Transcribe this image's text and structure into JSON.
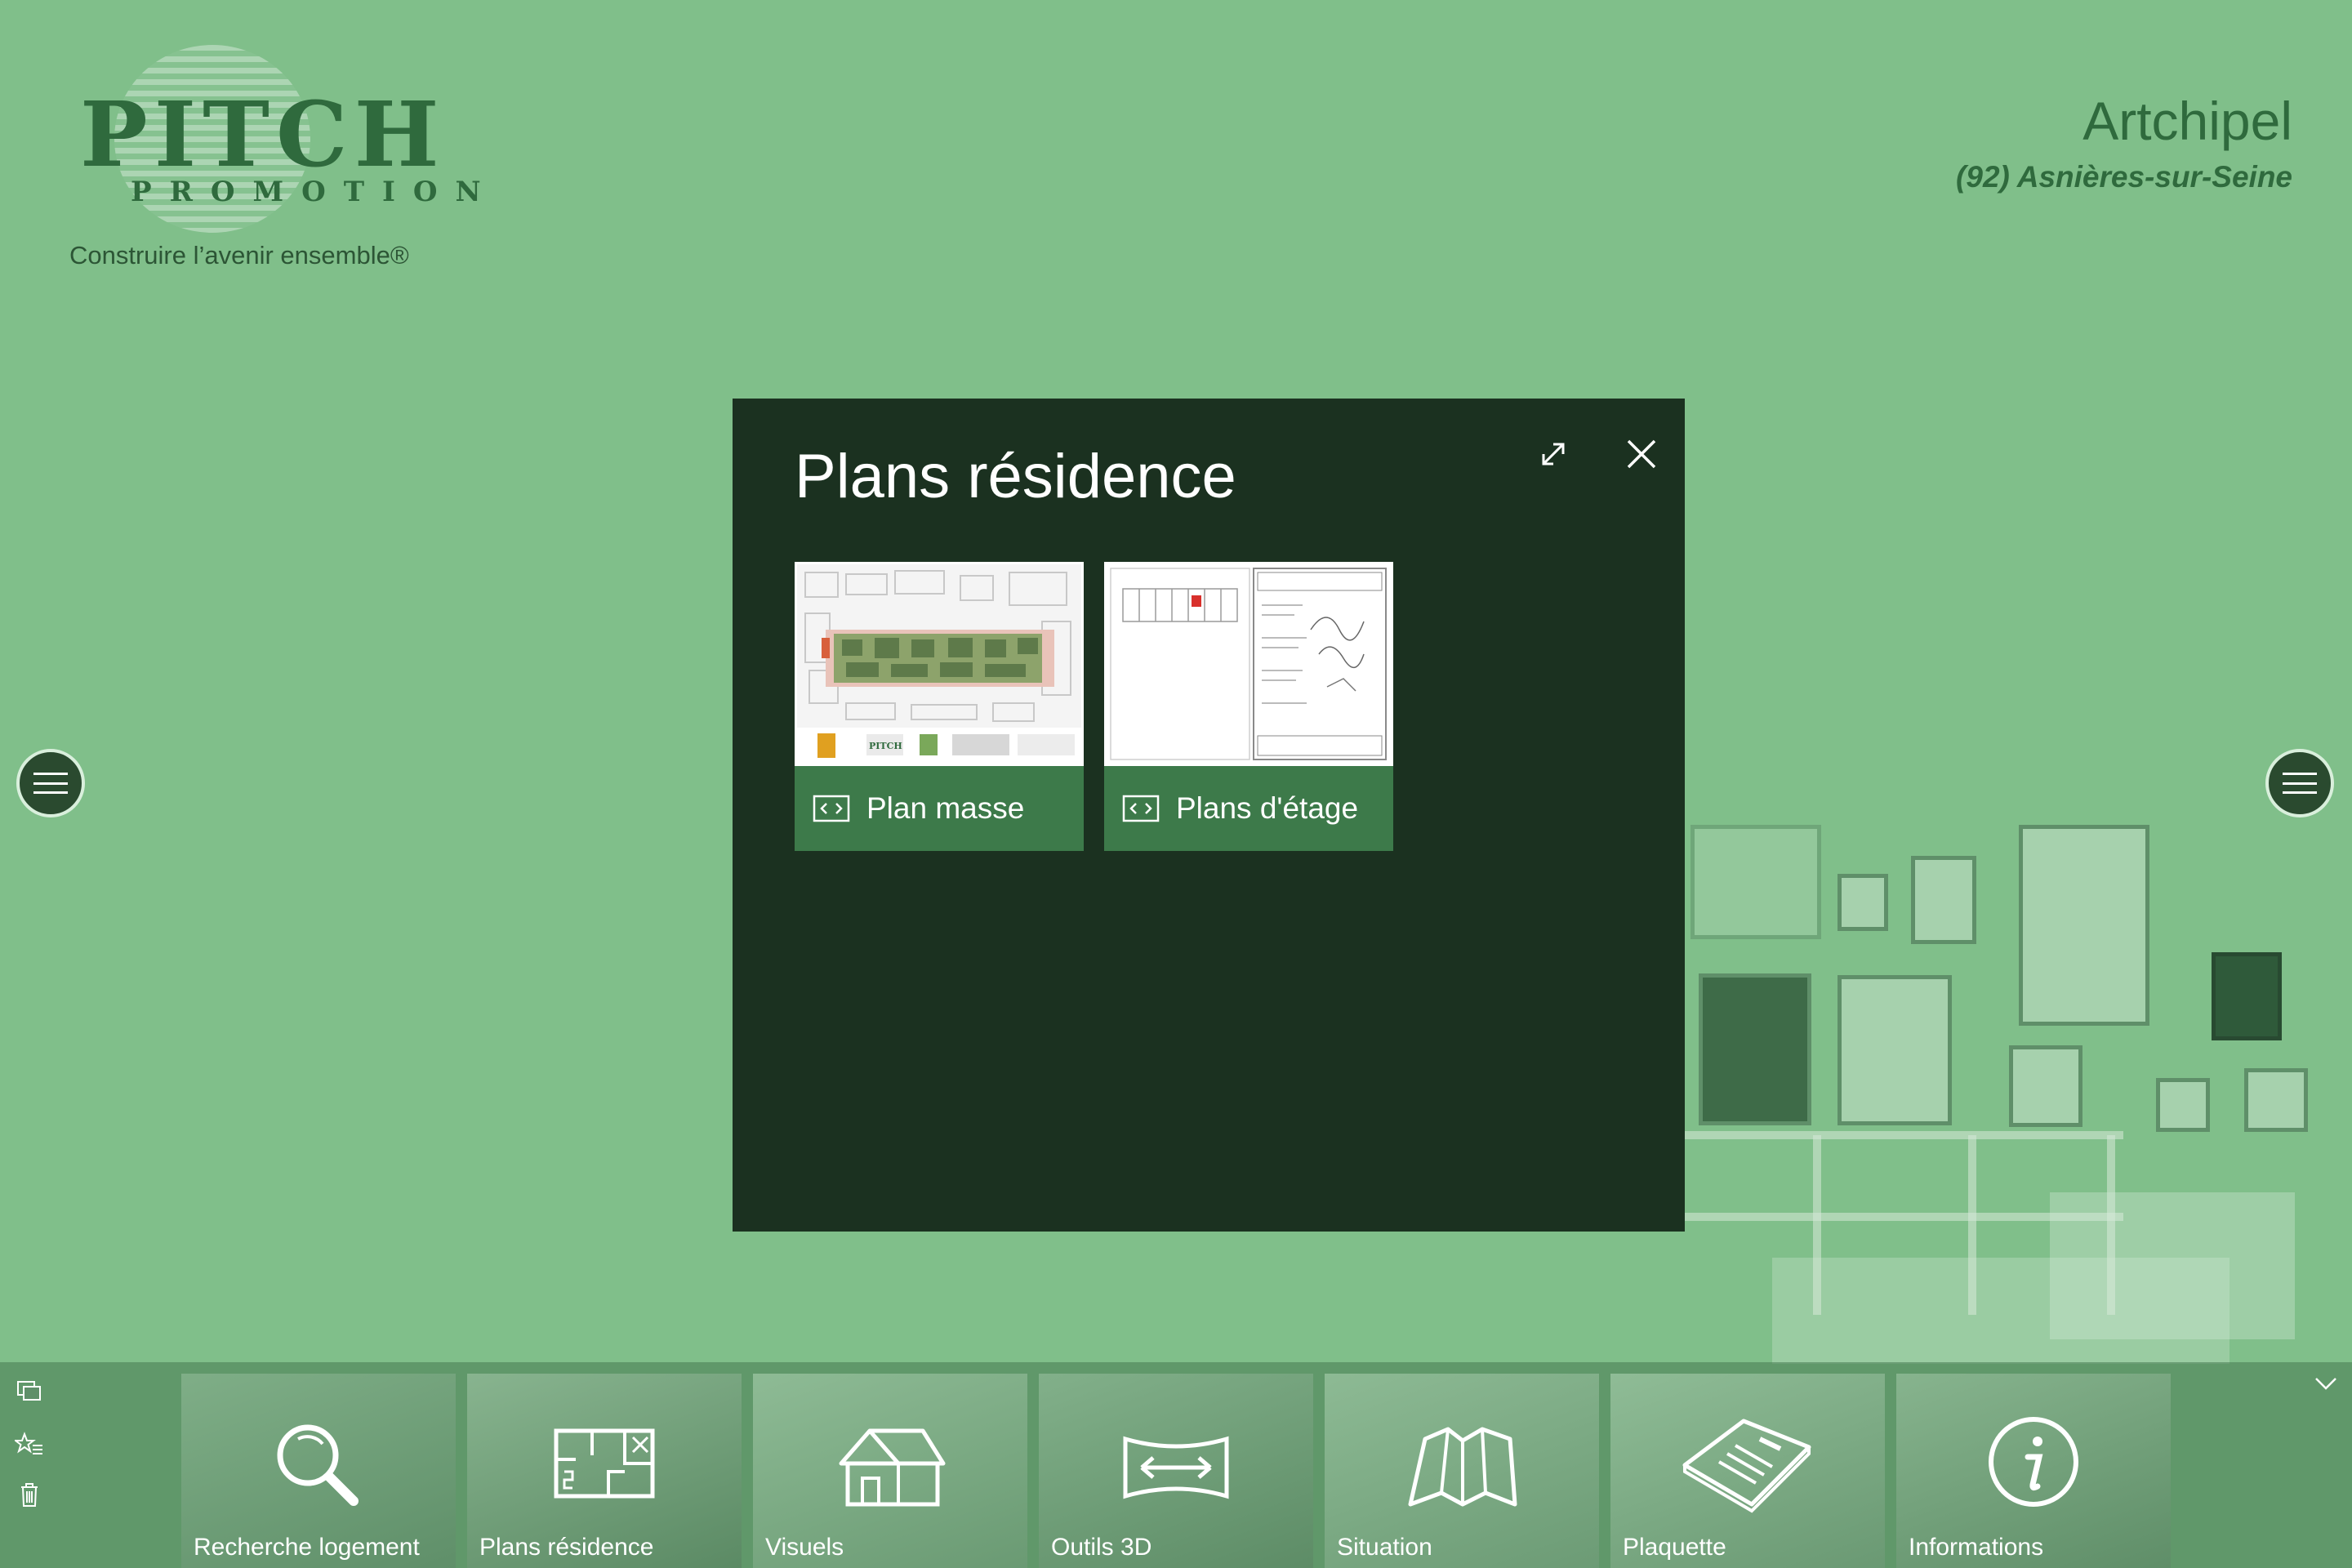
{
  "header": {
    "logo_word": "PITCH",
    "logo_sub": "PROMOTION",
    "tagline": "Construire l’avenir ensemble®",
    "project_name": "Artchipel",
    "project_location": "(92) Asnières-sur-Seine"
  },
  "dialog": {
    "title": "Plans résidence",
    "cards": [
      {
        "label": "Plan masse"
      },
      {
        "label": "Plans d'étage"
      }
    ]
  },
  "bottom_nav": {
    "items": [
      {
        "label": "Recherche logement",
        "icon": "magnifier-icon"
      },
      {
        "label": "Plans résidence",
        "icon": "floorplan-icon"
      },
      {
        "label": "Visuels",
        "icon": "house-icon"
      },
      {
        "label": "Outils 3D",
        "icon": "panorama-icon"
      },
      {
        "label": "Situation",
        "icon": "map-icon"
      },
      {
        "label": "Plaquette",
        "icon": "brochure-icon"
      },
      {
        "label": "Informations",
        "icon": "info-icon"
      }
    ]
  },
  "colors": {
    "background": "#80bf8a",
    "dialog": "#1b3120",
    "card_footer": "#3d7a4a",
    "brand": "#2f6a3d"
  }
}
